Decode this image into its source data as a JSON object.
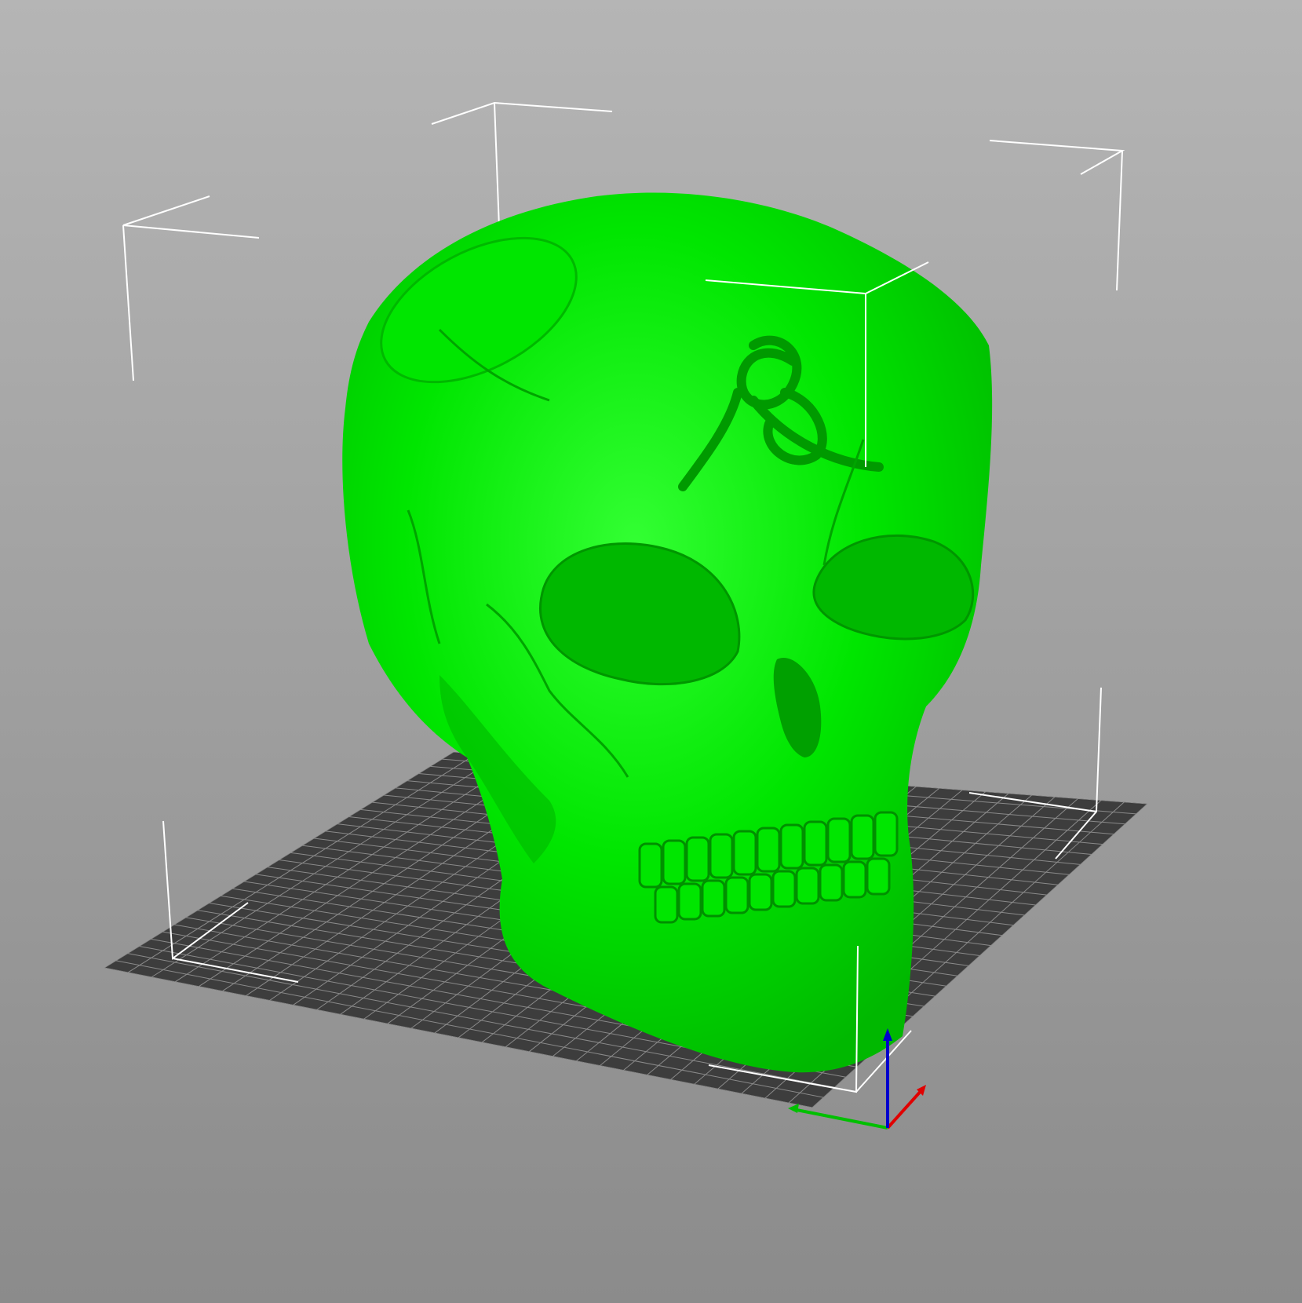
{
  "viewport": {
    "name": "3d-view",
    "background_top": "#b5b5b5",
    "background_bottom": "#8b8b8b"
  },
  "bed": {
    "plate_color": "#3d3d3d",
    "grid_color": "#8a8a8a",
    "grid_divisions": 30
  },
  "model": {
    "name": "skull",
    "color": "#00e600",
    "shade_color": "#00b800",
    "highlight_color": "#33ff33",
    "state": "selected"
  },
  "bounding_box": {
    "color": "#ffffff"
  },
  "axes": {
    "x_color": "#e00000",
    "y_color": "#00c000",
    "z_color": "#0000cc",
    "labels": [
      "x-axis",
      "y-axis",
      "z-axis"
    ]
  }
}
